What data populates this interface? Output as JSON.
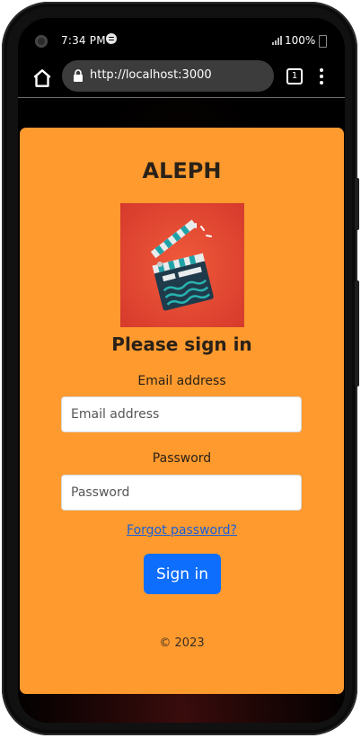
{
  "status_bar": {
    "time": "7:34 PM",
    "battery": "100%"
  },
  "browser": {
    "url": "http://localhost:3000",
    "tab_count": "1"
  },
  "login": {
    "brand": "ALEPH",
    "logo_alt": "clapperboard",
    "heading": "Please sign in",
    "email_label": "Email address",
    "email_placeholder": "Email address",
    "email_value": "",
    "password_label": "Password",
    "password_placeholder": "Password",
    "password_value": "",
    "forgot_link": "Forgot password?",
    "submit_label": "Sign in",
    "copyright": "© 2023"
  },
  "colors": {
    "card_background": "#fe9a2e",
    "primary_button": "#0d6efd",
    "link": "#1a5fd6"
  }
}
